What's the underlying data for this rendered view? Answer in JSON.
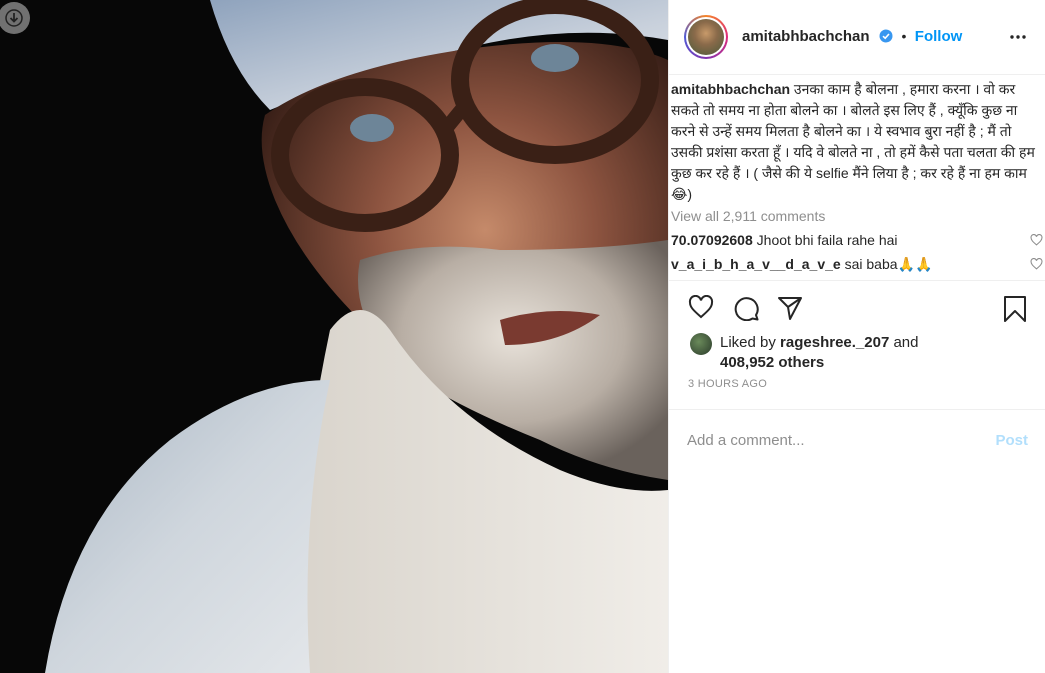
{
  "post": {
    "username": "amitabhbachchan",
    "separator": "•",
    "follow_label": "Follow",
    "caption_user": "amitabhbachchan",
    "caption_text": "उनका काम है बोलना , हमारा करना । वो कर सकते तो समय ना होता बोलने का । बोलते इस लिए हैं , क्यूँकि कुछ ना करने से उन्हें समय मिलता है बोलने का । ये स्वभाव बुरा नहीं है ; मैं तो उसकी प्रशंसा करता हूँ । यदि वे बोलते ना , तो हमें कैसे पता चलता की हम कुछ कर रहे हैं । ( जैसे की ये selfie मैंने लिया है ; कर रहे हैं ना हम काम 😂)",
    "view_all_comments": "View all 2,911 comments",
    "comments": [
      {
        "user": "70.07092608",
        "text": "Jhoot bhi faila rahe hai"
      },
      {
        "user": "v_a_i_b_h_a_v__d_a_v_e",
        "text": "sai baba🙏🙏"
      }
    ],
    "liked_by_prefix": "Liked by ",
    "liked_by_user": "rageshree._207",
    "liked_by_and": " and",
    "liked_by_others": "408,952 others",
    "timestamp": "3 HOURS AGO",
    "comment_placeholder": "Add a comment...",
    "post_label": "Post"
  },
  "icons": {
    "download": "download-icon",
    "verified": "verified-badge-icon",
    "more": "more-options-icon",
    "heart": "heart-icon",
    "comment": "comment-icon",
    "share": "share-icon",
    "save": "bookmark-icon"
  },
  "colors": {
    "link_blue": "#0095f6",
    "post_disabled": "#b2dffc",
    "muted": "#8e8e8e",
    "text": "#262626"
  }
}
